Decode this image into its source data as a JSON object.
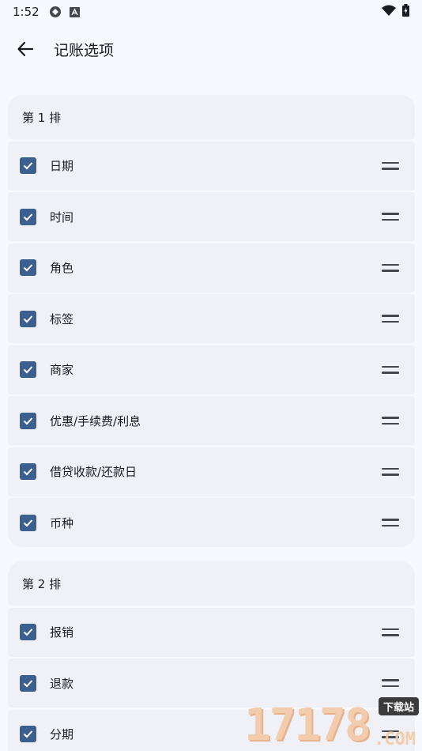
{
  "status_bar": {
    "time": "1:52",
    "icons": [
      "sync-icon",
      "font-a-icon"
    ],
    "right_icons": [
      "wifi-icon",
      "battery-charging-icon"
    ]
  },
  "app_bar": {
    "back_icon": "arrow-left-icon",
    "title": "记账选项"
  },
  "groups": [
    {
      "header": "第 1 排",
      "items": [
        {
          "label": "日期",
          "checked": true
        },
        {
          "label": "时间",
          "checked": true
        },
        {
          "label": "角色",
          "checked": true
        },
        {
          "label": "标签",
          "checked": true
        },
        {
          "label": "商家",
          "checked": true
        },
        {
          "label": "优惠/手续费/利息",
          "checked": true
        },
        {
          "label": "借贷收款/还款日",
          "checked": true
        },
        {
          "label": "币种",
          "checked": true
        }
      ]
    },
    {
      "header": "第 2 排",
      "items": [
        {
          "label": "报销",
          "checked": true
        },
        {
          "label": "退款",
          "checked": true
        },
        {
          "label": "分期",
          "checked": true
        }
      ]
    }
  ],
  "watermark": {
    "digits": "17178",
    "badge": "下载站",
    "suffix": ".COM"
  },
  "colors": {
    "background": "#f8f9fe",
    "card": "#f0f1f6",
    "checkbox": "#3b5f8f",
    "text": "#1b1c20"
  }
}
